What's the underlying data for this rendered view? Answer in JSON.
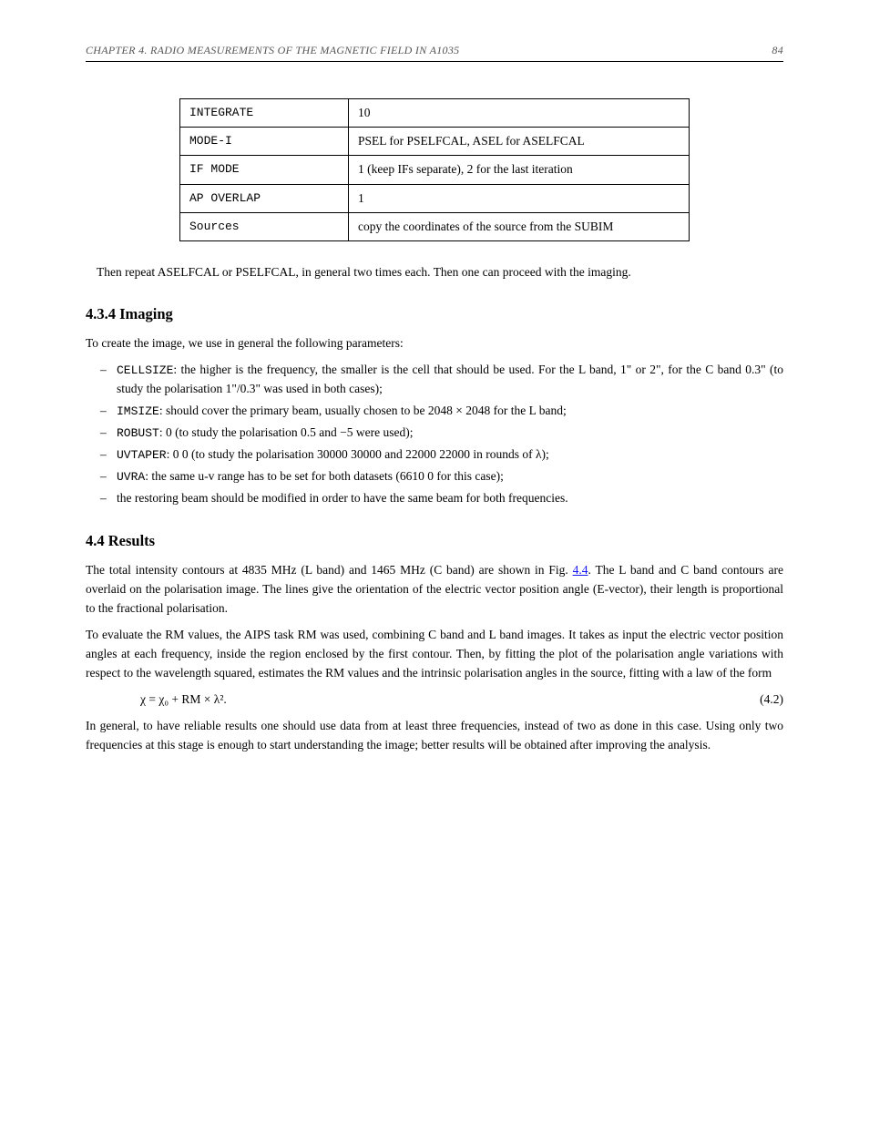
{
  "header": {
    "title": "CHAPTER 4. RADIO MEASUREMENTS OF THE MAGNETIC FIELD IN A1035",
    "page": "84"
  },
  "table": {
    "rows": [
      {
        "field": "INTEGRATE",
        "value": "10"
      },
      {
        "field": "MODE-I",
        "value": "PSEL for PSELFCAL, ASEL for ASELFCAL"
      },
      {
        "field": "IF MODE",
        "value": "1 (keep IFs separate), 2 for the last iteration"
      },
      {
        "field": "AP OVERLAP",
        "value": "1"
      },
      {
        "field": "Sources",
        "value": "copy the coordinates of the source from the SUBIM"
      }
    ]
  },
  "note_text": "Then repeat ASELFCAL or PSELFCAL, in general two times each. Then one can proceed with the imaging.",
  "imaging": {
    "heading": "4.3.4 Imaging",
    "intro": "To create the image, we use in general the following parameters:",
    "bullets": [
      {
        "html": "<span class=\"mono\">CELLSIZE</span>: the higher is the frequency, the smaller is the cell that should be used. For the L band, 1\" or 2\", for the C band 0.3\" (to study the polarisation 1\"/0.3\" was used in both cases);"
      },
      {
        "html": "<span class=\"mono\">IMSIZE</span>: should cover the primary beam, usually chosen to be 2048 × 2048 for the L band;"
      },
      {
        "html": "<span class=\"mono\">ROBUST</span>: 0 (to study the polarisation 0.5 and −5 were used);"
      },
      {
        "html": "<span class=\"mono\">UVTAPER</span>: 0 0 (to study the polarisation 30000 30000 and 22000 22000 in rounds of λ);"
      },
      {
        "html": "<span class=\"mono\">UVRA</span>: the same u-v range has to be set for both datasets (6610 0 for this case);"
      },
      {
        "html": "the restoring beam should be modified in order to have the same beam for both frequencies."
      }
    ]
  },
  "results": {
    "heading": "4.4 Results",
    "p1_pre": "The total intensity contours at 4835 MHz (L band) and 1465 MHz (C band) are shown in Fig. ",
    "p1_link": "4.4",
    "p1_post": ". The L band and C band contours are overlaid on the polarisation image. The lines give the orientation of the electric vector position angle (E-vector), their length is proportional to the fractional polarisation.",
    "p2": "To evaluate the RM values, the AIPS task RM was used, combining C band and L band images. It takes as input the electric vector position angles at each frequency, inside the region enclosed by the first contour. Then, by fitting the plot of the polarisation angle variations with respect to the wavelength squared, estimates the RM values and the intrinsic polarisation angles in the source, fitting with a law of the form",
    "eq_left": "χ = χ₀ + RM × λ².",
    "eq_num": "(4.2)",
    "p3": "In general, to have reliable results one should use data from at least three frequencies, instead of two as done in this case. Using only two frequencies at this stage is enough to start understanding the image; better results will be obtained after improving the analysis."
  }
}
